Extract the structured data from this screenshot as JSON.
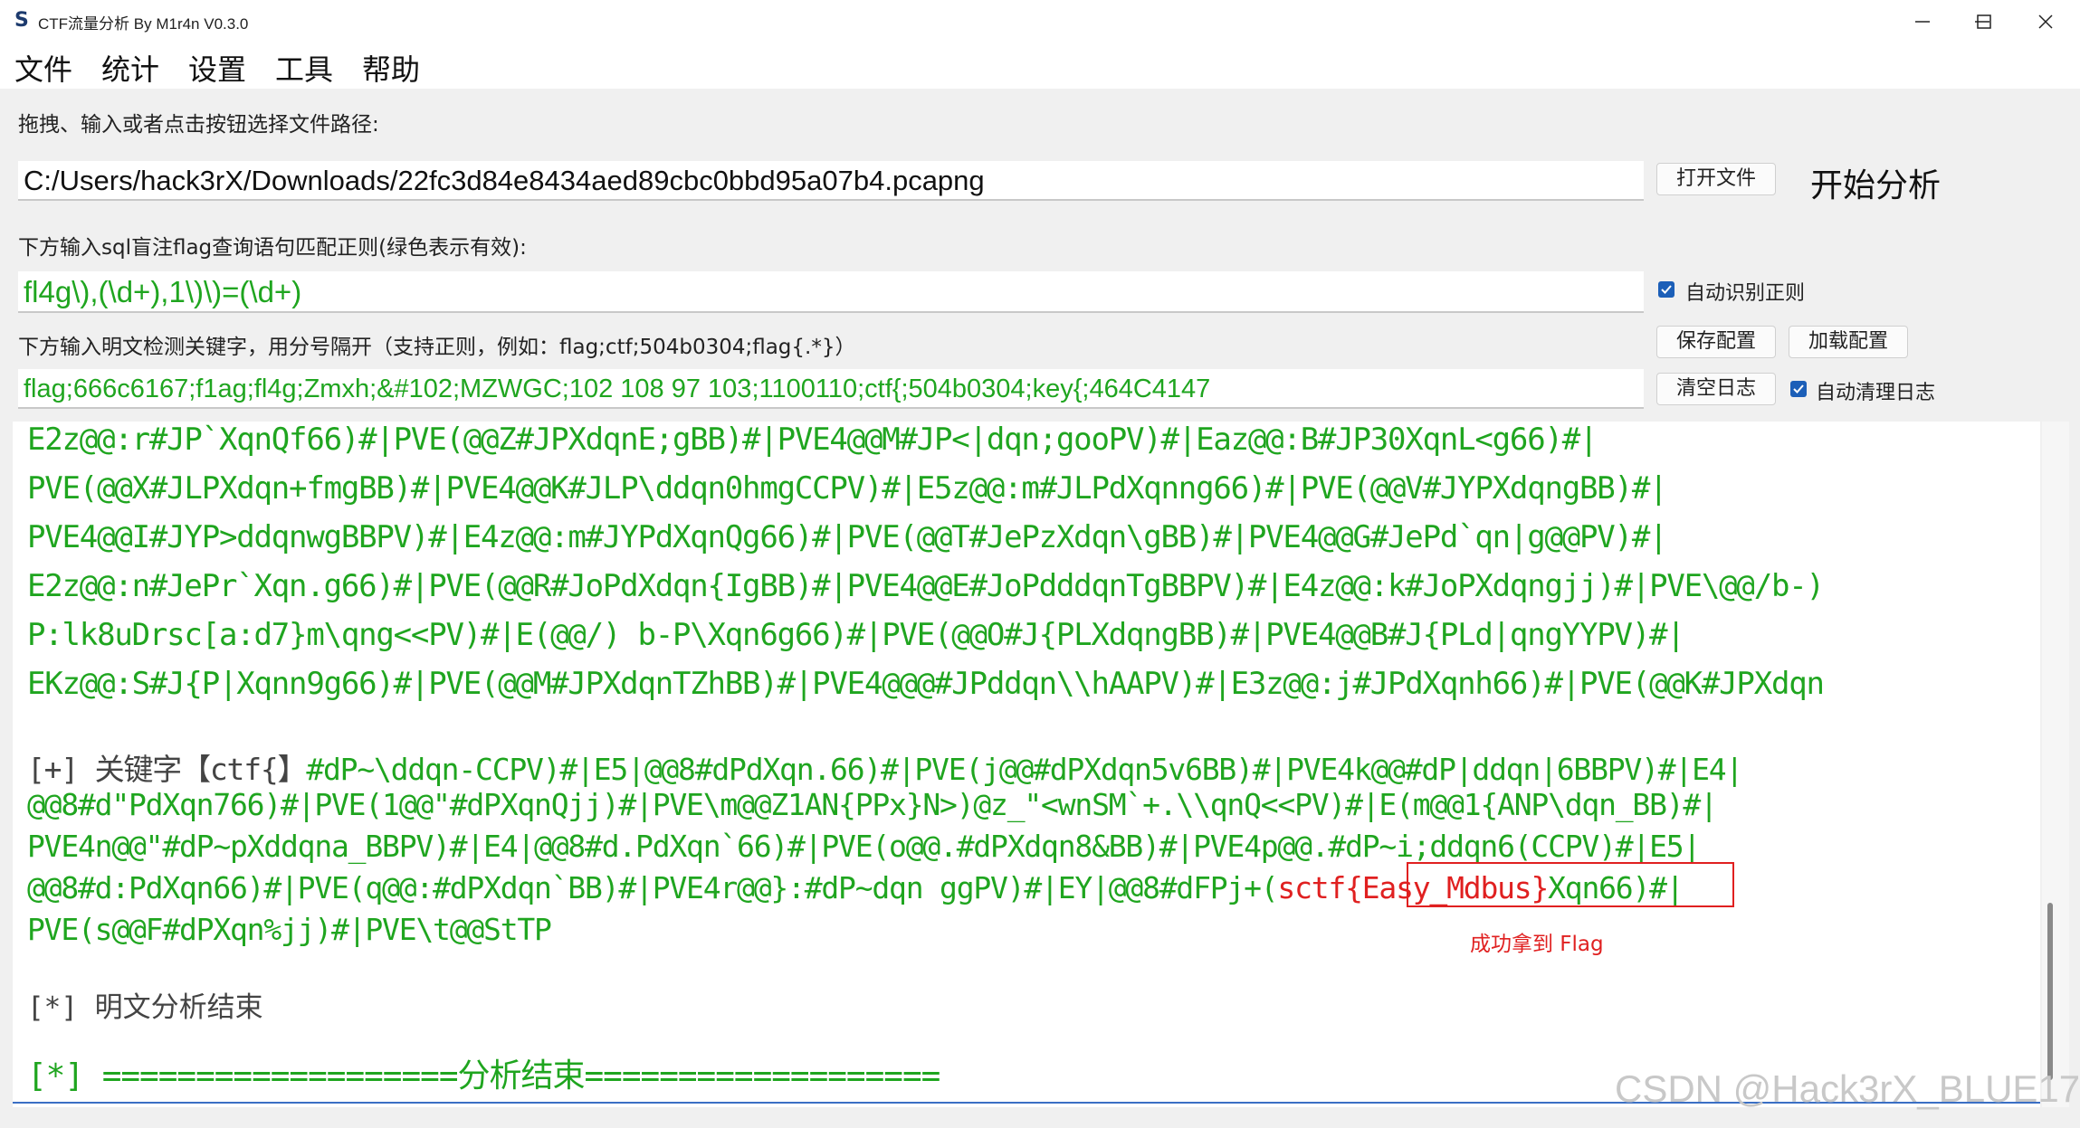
{
  "window": {
    "title": "CTF流量分析 By M1r4n V0.3.0",
    "app_icon_glyph": "S"
  },
  "menu": [
    "文件",
    "统计",
    "设置",
    "工具",
    "帮助"
  ],
  "file_path": {
    "label": "拖拽、输入或者点击按钮选择文件路径:",
    "value": "C:/Users/hack3rX/Downloads/22fc3d84e8434aed89cbc0bbd95a07b4.pcapng",
    "open_button": "打开文件",
    "start_button": "开始分析"
  },
  "sql_regex": {
    "label": "下方输入sql盲注flag查询语句匹配正则(绿色表示有效):",
    "value": "fl4g\\),(\\d+),1\\)\\)=(\\d+)",
    "auto_detect_label": "自动识别正则",
    "auto_detect_checked": true
  },
  "keywords": {
    "label": "下方输入明文检测关键字，用分号隔开（支持正则，例如：flag;ctf;504b0304;flag{.*}）",
    "value": "flag;666c6167;f1ag;fl4g;Zmxh;&#102;MZWGC;102 108 97 103;1100110;ctf{;504b0304;key{;464C4147",
    "save_button": "保存配置",
    "load_button": "加载配置",
    "clear_button": "清空日志",
    "auto_clear_label": "自动清理日志",
    "auto_clear_checked": true
  },
  "output": {
    "lines_top": [
      "E2z@@:r#JP`XqnQf66)#|PVE(@@Z#JPXdqnE;gBB)#|PVE4@@M#JP<|dqn;gooPV)#|Eaz@@:B#JP30XqnL<g66)#|",
      "PVE(@@X#JLPXdqn+fmgBB)#|PVE4@@K#JLP\\ddqn0hmgCCPV)#|E5z@@:m#JLPdXqnng66)#|PVE(@@V#JYPXdqngBB)#|",
      "PVE4@@I#JYP>ddqnwgBBPV)#|E4z@@:m#JYPdXqnQg66)#|PVE(@@T#JePzXdqn\\gBB)#|PVE4@@G#JePd`qn|g@@PV)#|",
      "E2z@@:n#JePr`Xqn.g66)#|PVE(@@R#JoPdXdqn{IgBB)#|PVE4@@E#JoPdddqnTgBBPV)#|E4z@@:k#JoPXdqngjj)#|PVE\\@@/b-)",
      "P:lk8uDrsc[a:d7}m\\qng<<PV)#|E(@@/) b-P\\Xqn6g66)#|PVE(@@O#J{PLXdqngBB)#|PVE4@@B#J{PLd|qngYYPV)#|",
      "EKz@@:S#J{P|Xqnn9g66)#|PVE(@@M#JPXdqnTZhBB)#|PVE4@@@#JPddqn\\\\hAAPV)#|E3z@@:j#JPdXqnh66)#|PVE(@@K#JPXdqn"
    ],
    "keyword_prefix": "[+] 关键字【ctf{】",
    "keyword_line_1_rest": "#dP~\\ddqn-CCPV)#|E5|@@8#dPdXqn.66)#|PVE(j@@#dPXdqn5v6BB)#|PVE4k@@#dP|ddqn|6BBPV)#|E4|",
    "keyword_lines": [
      "@@8#d\"PdXqn766)#|PVE(1@@\"#dPXqnQjj)#|PVE\\m@@Z1AN{PPx}N>)@z_\"<wnSM`+.\\\\qnQ<<PV)#|E(m@@1{ANP\\dqn_BB)#|",
      "PVE4n@@\"#dP~pXddqna_BBPV)#|E4|@@8#d.PdXqn`66)#|PVE(o@@.#dPXdqn8&BB)#|PVE4p@@.#dP~i;ddqn6(CCPV)#|E5|"
    ],
    "flag_line_prefix": "@@8#d:PdXqn66)#|PVE(q@@:#dPXdqn`BB)#|PVE4r@@}:#dP~dqn ggPV)#|EY|@@8#dFPj+(",
    "flag_s": "s",
    "flag_text": "ctf{Easy_Mdbus}",
    "flag_line_suffix": "Xqn66)#|",
    "after_flag_line": "PVE(s@@F#dPXqn%jj)#|PVE\\t@@StTP",
    "plain_end": "[*] 明文分析结束",
    "analysis_end": "[*] ===================分析结束===================",
    "annotation": "成功拿到 Flag"
  },
  "watermark": "CSDN @Hack3rX_BLUE17",
  "colors": {
    "output_green": "#1fa51f",
    "highlight_red": "#e02020",
    "checkbox_blue": "#1c5fb8"
  }
}
